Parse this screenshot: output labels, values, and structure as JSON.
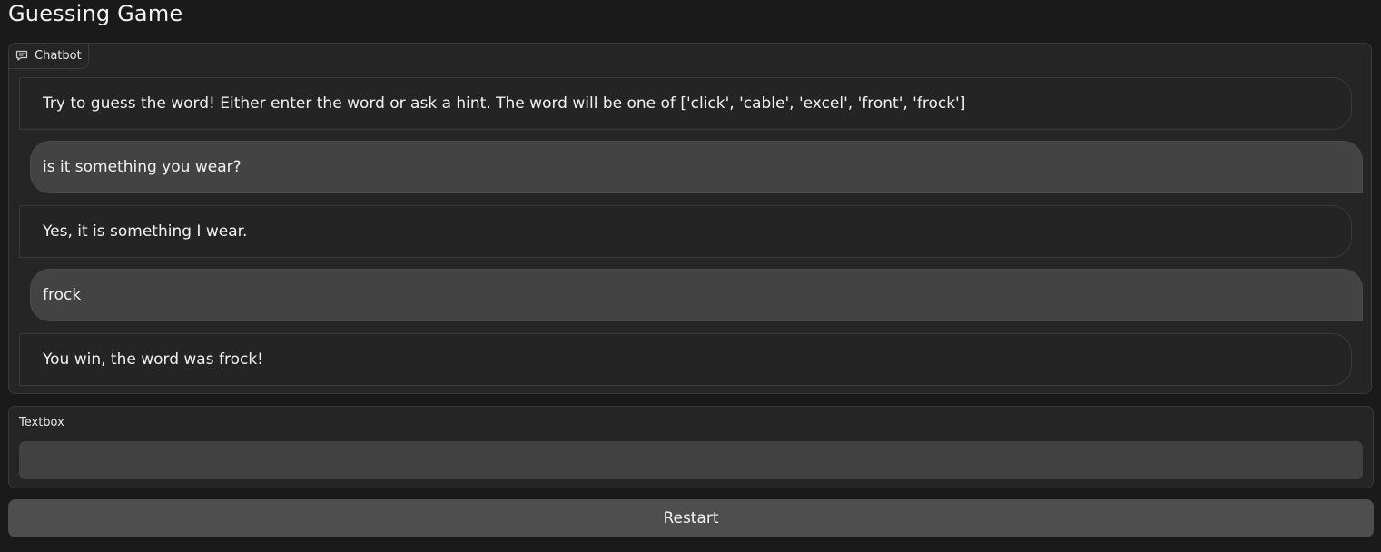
{
  "app": {
    "title": "Guessing Game"
  },
  "chatbot": {
    "label": "Chatbot",
    "icon": "chat-bubble-icon",
    "messages": [
      {
        "role": "bot",
        "text": "Try to guess the word! Either enter the word or ask a hint. The word will be one of ['click', 'cable', 'excel', 'front', 'frock']"
      },
      {
        "role": "user",
        "text": "is it something you wear?"
      },
      {
        "role": "bot",
        "text": "Yes, it is something I wear."
      },
      {
        "role": "user",
        "text": "frock"
      },
      {
        "role": "bot",
        "text": "You win, the word was frock!"
      }
    ]
  },
  "textbox": {
    "label": "Textbox",
    "value": "",
    "placeholder": ""
  },
  "restart": {
    "label": "Restart"
  },
  "colors": {
    "background": "#1a1a1a",
    "panel": "#252525",
    "user_bubble": "#434343",
    "button": "#4e4e4e"
  }
}
